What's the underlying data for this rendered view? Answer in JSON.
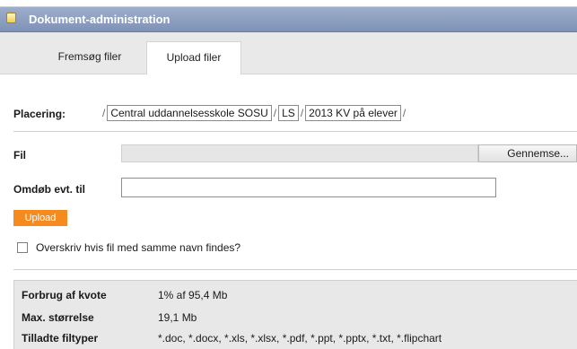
{
  "window": {
    "title": "Dokument-administration",
    "icon": "document-icon"
  },
  "tabs": [
    {
      "label": "Fremsøg filer",
      "active": false
    },
    {
      "label": "Upload filer",
      "active": true
    }
  ],
  "placement": {
    "label": "Placering:",
    "separator": "/",
    "crumbs": [
      "Central uddannelsesskole SOSU",
      "LS",
      "2013 KV på elever"
    ]
  },
  "file": {
    "label": "Fil",
    "value": "",
    "browse_label": "Gennemse..."
  },
  "rename": {
    "label": "Omdøb evt. til",
    "value": ""
  },
  "upload_button": "Upload",
  "overwrite": {
    "label": "Overskriv hvis fil med samme navn findes?",
    "checked": false
  },
  "info": [
    {
      "key": "Forbrug af kvote",
      "value": "1% af 95,4 Mb"
    },
    {
      "key": "Max. størrelse",
      "value": "19,1 Mb"
    },
    {
      "key": "Tilladte filtyper",
      "value": "*.doc, *.docx, *.xls, *.xlsx, *.pdf, *.ppt, *.pptx, *.txt, *.flipchart"
    }
  ],
  "colors": {
    "titlebar": "#8a9cbf",
    "upload_button": "#f58a1f",
    "tabbar": "#e9e9e9",
    "infobox": "#e8e8e8"
  }
}
